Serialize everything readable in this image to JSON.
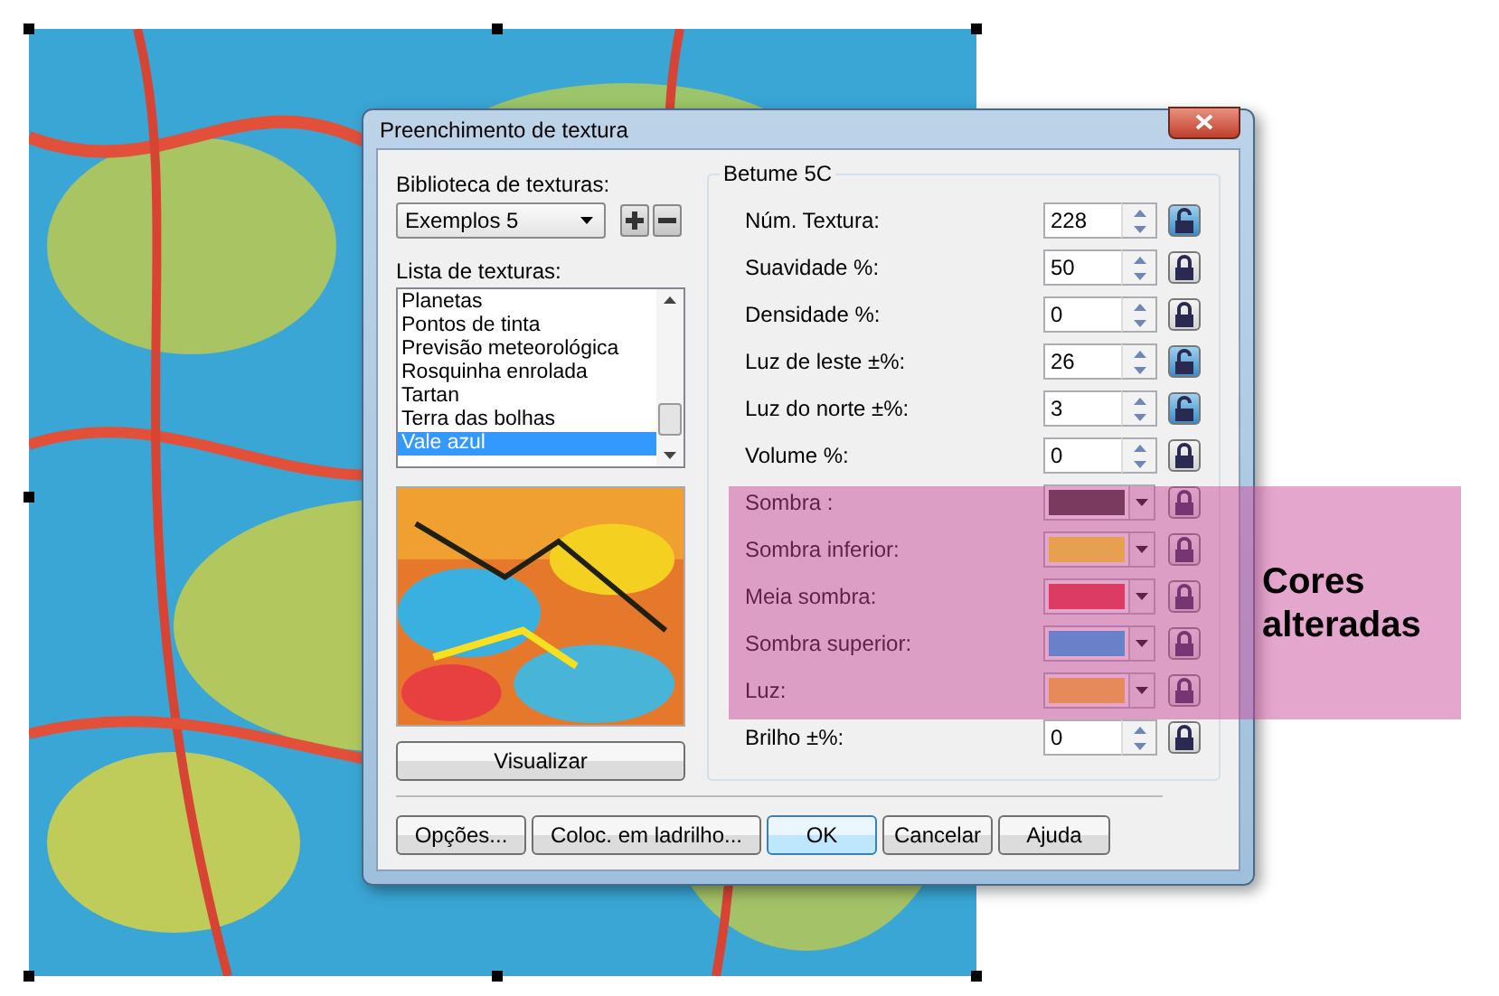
{
  "window": {
    "title": "Preenchimento de textura"
  },
  "library": {
    "label": "Biblioteca de texturas:",
    "value": "Exemplos 5"
  },
  "list": {
    "label": "Lista de texturas:",
    "items": [
      {
        "label": "Planetas",
        "selected": false
      },
      {
        "label": "Pontos de tinta",
        "selected": false
      },
      {
        "label": "Previsão meteorológica",
        "selected": false
      },
      {
        "label": "Rosquinha enrolada",
        "selected": false
      },
      {
        "label": "Tartan",
        "selected": false
      },
      {
        "label": "Terra das bolhas",
        "selected": false
      },
      {
        "label": "Vale azul",
        "selected": true
      }
    ]
  },
  "preview_button": "Visualizar",
  "group": {
    "title": "Betume 5C",
    "rows": [
      {
        "kind": "number",
        "label": "Núm. Textura:",
        "value": "228",
        "locked": false
      },
      {
        "kind": "number",
        "label": "Suavidade %:",
        "value": "50",
        "locked": true
      },
      {
        "kind": "number",
        "label": "Densidade %:",
        "value": "0",
        "locked": true
      },
      {
        "kind": "number",
        "label": "Luz de leste ±%:",
        "value": "26",
        "locked": false
      },
      {
        "kind": "number",
        "label": "Luz do norte ±%:",
        "value": "3",
        "locked": false
      },
      {
        "kind": "number",
        "label": "Volume %:",
        "value": "0",
        "locked": true
      },
      {
        "kind": "color",
        "label": "Sombra :",
        "color": "#7a3a60",
        "locked": true
      },
      {
        "kind": "color",
        "label": "Sombra inferior:",
        "color": "#e6a050",
        "locked": true
      },
      {
        "kind": "color",
        "label": "Meia sombra:",
        "color": "#dc3c64",
        "locked": true
      },
      {
        "kind": "color",
        "label": "Sombra superior:",
        "color": "#6a80c8",
        "locked": true
      },
      {
        "kind": "color",
        "label": "Luz:",
        "color": "#e68a5c",
        "locked": true
      },
      {
        "kind": "number",
        "label": "Brilho ±%:",
        "value": "0",
        "locked": true
      }
    ]
  },
  "buttons": [
    {
      "label": "Opções...",
      "default": false
    },
    {
      "label": "Coloc. em ladrilho...",
      "default": false
    },
    {
      "label": "OK",
      "default": true
    },
    {
      "label": "Cancelar",
      "default": false
    },
    {
      "label": "Ajuda",
      "default": false
    }
  ],
  "annotation": {
    "text": "Cores alteradas"
  }
}
